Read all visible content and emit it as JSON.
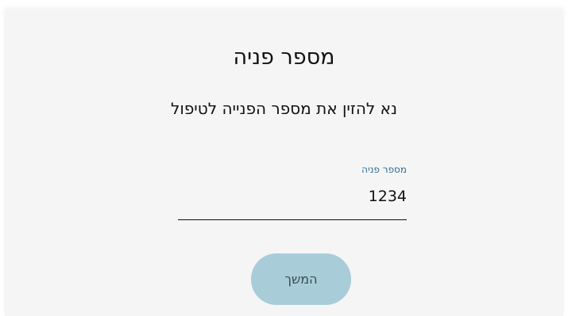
{
  "form": {
    "title": "מספר פניה",
    "instructions": "נא להזין את מספר הפנייה לטיפול",
    "field": {
      "label": "מספר פניה",
      "value": "1234"
    },
    "continue_label": "המשך"
  },
  "colors": {
    "card_background": "#f5f5f6",
    "label_color": "#2e6f92",
    "button_background": "#a8cdd8"
  }
}
